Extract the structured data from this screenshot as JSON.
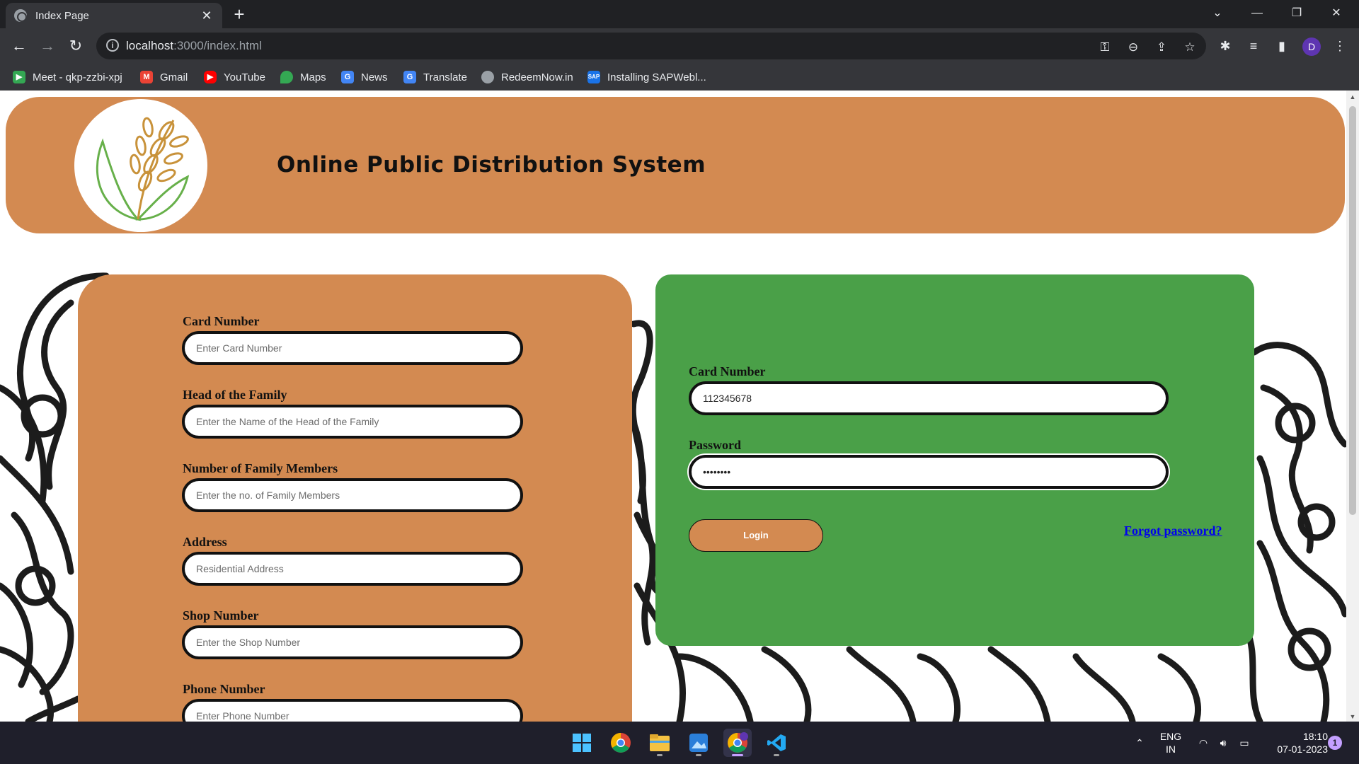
{
  "browser": {
    "tab_title": "Index Page",
    "url_host": "localhost",
    "url_path": ":3000/index.html",
    "bookmarks": [
      {
        "label": "Meet - qkp-zzbi-xpj",
        "icon": "meet-icon",
        "color": "#34a853"
      },
      {
        "label": "Gmail",
        "icon": "gmail-icon",
        "color": "#ea4335"
      },
      {
        "label": "YouTube",
        "icon": "youtube-icon",
        "color": "#ff0000"
      },
      {
        "label": "Maps",
        "icon": "maps-icon",
        "color": "#4285f4"
      },
      {
        "label": "News",
        "icon": "news-icon",
        "color": "#4285f4"
      },
      {
        "label": "Translate",
        "icon": "translate-icon",
        "color": "#4285f4"
      },
      {
        "label": "RedeemNow.in",
        "icon": "globe-icon",
        "color": "#9aa0a6"
      },
      {
        "label": "Installing SAPWebl...",
        "icon": "sap-icon",
        "color": "#1a73e8"
      }
    ],
    "profile_initial": "D"
  },
  "page": {
    "site_title": "Online Public Distribution System",
    "registration": {
      "fields": [
        {
          "label": "Card Number",
          "placeholder": "Enter Card Number"
        },
        {
          "label": "Head of the Family",
          "placeholder": "Enter the Name of the Head of the Family"
        },
        {
          "label": "Number of Family Members",
          "placeholder": "Enter the no. of Family Members"
        },
        {
          "label": "Address",
          "placeholder": "Residential Address"
        },
        {
          "label": "Shop Number",
          "placeholder": "Enter the Shop Number"
        },
        {
          "label": "Phone Number",
          "placeholder": "Enter Phone Number"
        }
      ]
    },
    "login": {
      "card_label": "Card Number",
      "card_value": "112345678",
      "password_label": "Password",
      "password_value": "••••••••",
      "login_button": "Login",
      "forgot_link": "Forgot password?"
    },
    "colors": {
      "orange": "#d38a51",
      "green": "#4aa048"
    }
  },
  "taskbar": {
    "lang_top": "ENG",
    "lang_bottom": "IN",
    "time": "18:10",
    "date": "07-01-2023",
    "notification_count": "1"
  }
}
